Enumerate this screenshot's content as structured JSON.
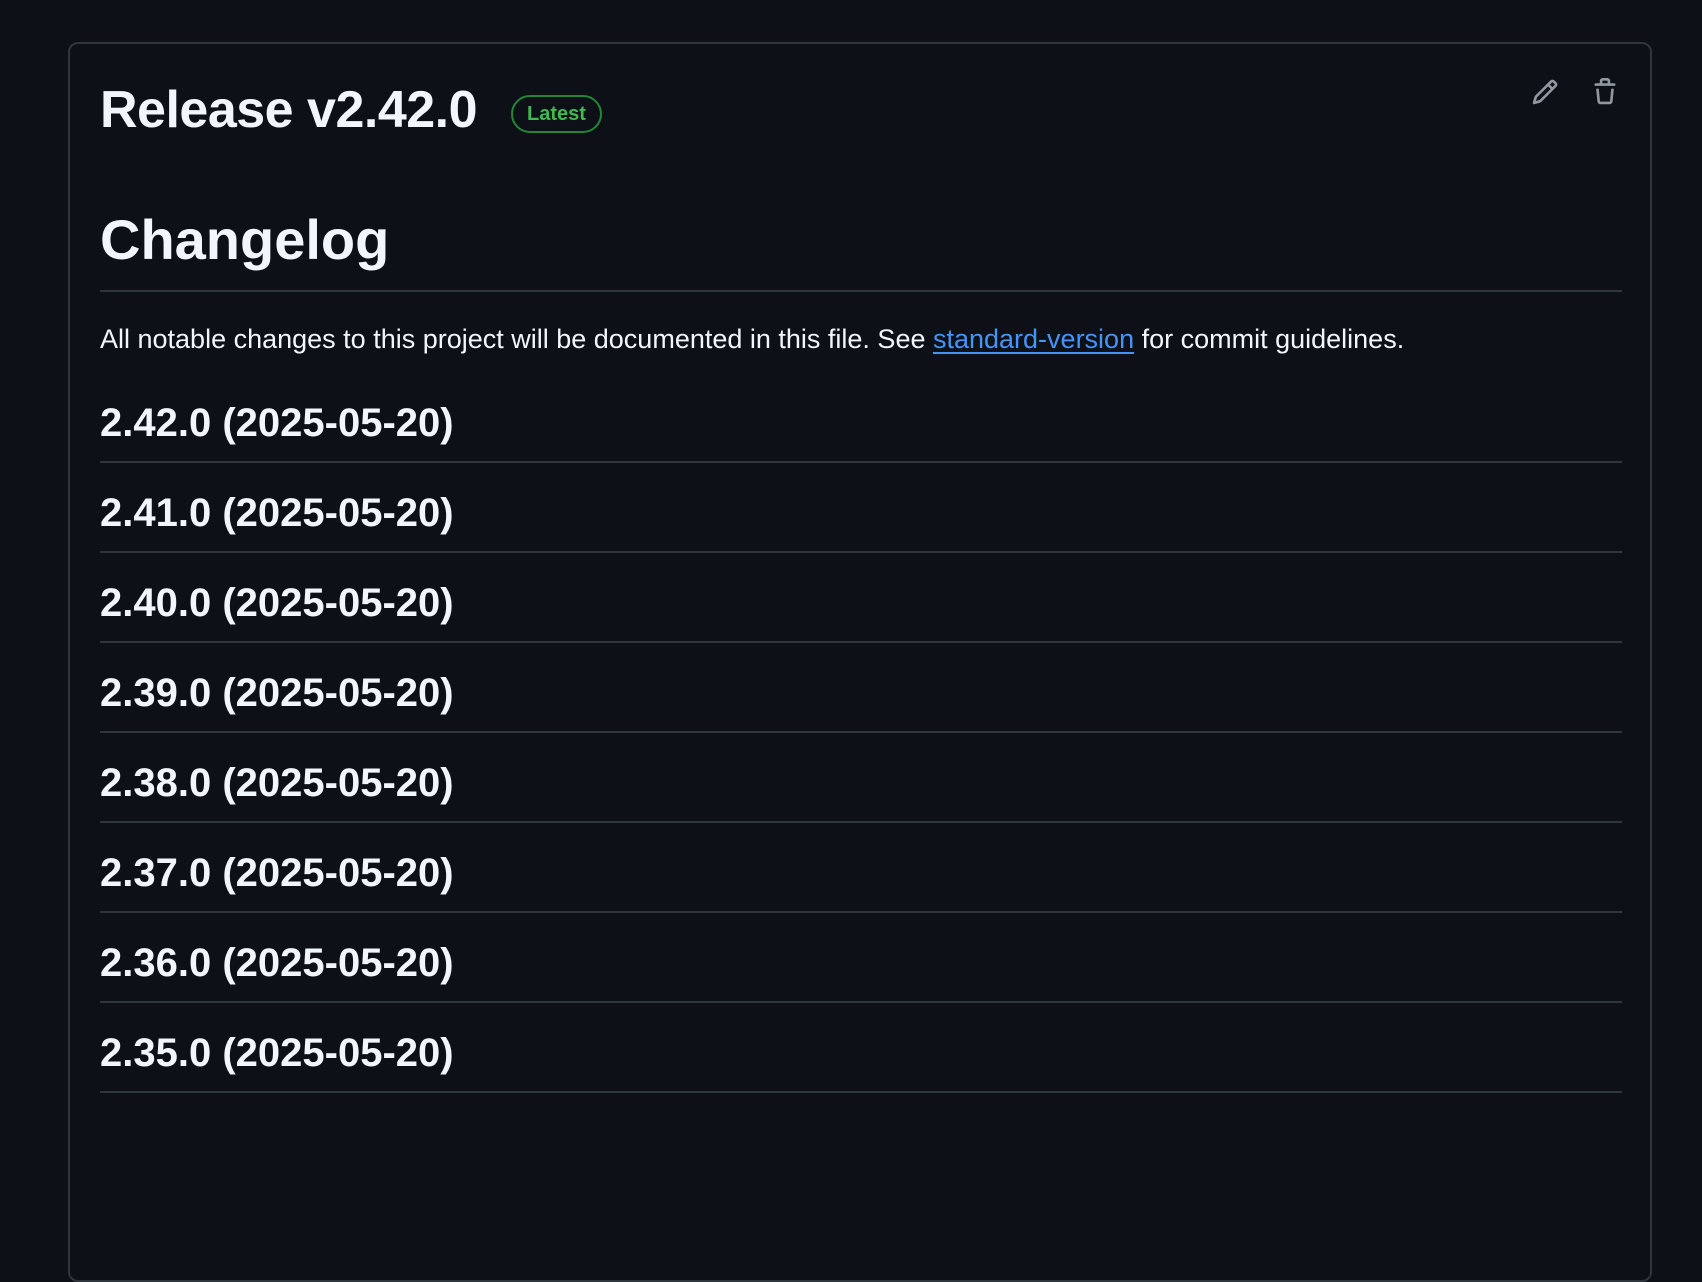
{
  "release": {
    "title": "Release v2.42.0",
    "badge": "Latest"
  },
  "actions": {
    "edit_icon": "pencil-icon",
    "delete_icon": "trash-icon"
  },
  "changelog": {
    "heading": "Changelog",
    "intro_before": "All notable changes to this project will be documented in this file. See ",
    "intro_link": "standard-version",
    "intro_after": " for commit guidelines.",
    "versions": [
      "2.42.0 (2025-05-20)",
      "2.41.0 (2025-05-20)",
      "2.40.0 (2025-05-20)",
      "2.39.0 (2025-05-20)",
      "2.38.0 (2025-05-20)",
      "2.37.0 (2025-05-20)",
      "2.36.0 (2025-05-20)",
      "2.35.0 (2025-05-20)"
    ]
  },
  "colors": {
    "background": "#0d1117",
    "border": "#30363d",
    "text": "#f0f6fc",
    "link": "#4493f8",
    "badge_green": "#3fb950"
  }
}
